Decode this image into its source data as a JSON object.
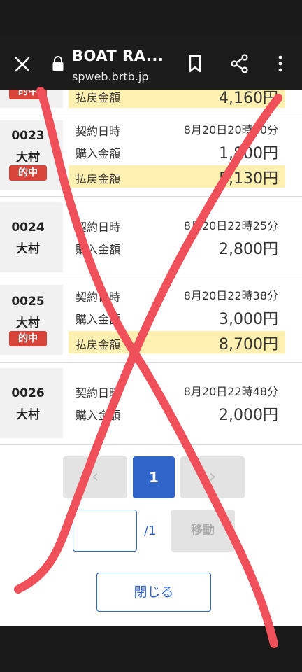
{
  "browser": {
    "title": "BOAT RA...",
    "url": "spweb.brtb.jp"
  },
  "labels": {
    "contract_time": "契約日時",
    "purchase_amount": "購入金額",
    "payout_amount": "払戻金額",
    "hit": "的中"
  },
  "partial_row": {
    "badge": "的中",
    "payout_label": "払戻金額",
    "payout": "4,160円"
  },
  "rows": [
    {
      "no": "0023",
      "place": "大村",
      "hit": true,
      "time": "8月20日20時40分",
      "purchase": "1,800円",
      "payout": "5,130円"
    },
    {
      "no": "0024",
      "place": "大村",
      "hit": false,
      "time": "8月20日22時25分",
      "purchase": "2,800円"
    },
    {
      "no": "0025",
      "place": "大村",
      "hit": true,
      "time": "8月20日22時38分",
      "purchase": "3,000円",
      "payout": "8,700円"
    },
    {
      "no": "0026",
      "place": "大村",
      "hit": false,
      "time": "8月20日22時48分",
      "purchase": "2,000円"
    }
  ],
  "pagination": {
    "prev": "‹",
    "current": "1",
    "next": "›",
    "input_value": "",
    "total": "/1",
    "move_label": "移動"
  },
  "close_label": "閉じる",
  "colors": {
    "accent_blue": "#2f64c8",
    "hit_red": "#d9443a",
    "highlight_yellow": "#fdf0b0",
    "annotation_x": "#f0505a"
  }
}
